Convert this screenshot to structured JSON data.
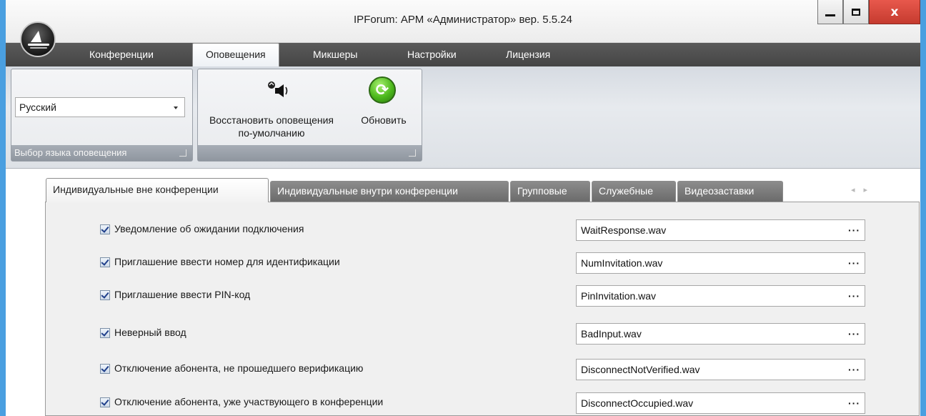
{
  "window": {
    "title": "IPForum: АРМ «Администратор» вер. 5.5.24",
    "controls": {
      "minimize": "minimize-icon",
      "maximize": "maximize-icon",
      "close": "close-icon",
      "close_glyph": "x"
    }
  },
  "menu": {
    "items": [
      "Конференции",
      "Оповещения",
      "Микшеры",
      "Настройки",
      "Лицензия"
    ],
    "active": "Оповещения"
  },
  "ribbon": {
    "language_group": {
      "selected": "Русский",
      "caption": "Выбор языка оповещения"
    },
    "actions_group": {
      "restore_line1": "Восстановить оповещения",
      "restore_line2": "по-умолчанию",
      "refresh_label": "Обновить"
    }
  },
  "tabs": {
    "items": [
      "Индивидуальные вне конференции",
      "Индивидуальные внутри конференции",
      "Групповые",
      "Служебные",
      "Видеозаставки"
    ],
    "active": "Индивидуальные вне конференции"
  },
  "notifications": [
    {
      "label": "Уведомление об ожидании подключения",
      "checked": true,
      "file": "WaitResponse.wav"
    },
    {
      "label": "Приглашение ввести номер для идентификации",
      "checked": true,
      "file": "NumInvitation.wav"
    },
    {
      "label": "Приглашение ввести PIN-код",
      "checked": true,
      "file": "PinInvitation.wav"
    },
    {
      "label": "Неверный ввод",
      "checked": true,
      "file": "BadInput.wav"
    },
    {
      "label": "Отключение абонента, не прошедшего верификацию",
      "checked": true,
      "file": "DisconnectNotVerified.wav"
    },
    {
      "label": "Отключение абонента, уже участвующего в конференции",
      "checked": true,
      "file": "DisconnectOccupied.wav"
    }
  ],
  "browse_label": "···",
  "colors": {
    "accent_frame": "#4a9fe0",
    "menubar": "#4f4f4f",
    "refresh_green": "#4cb81c"
  }
}
